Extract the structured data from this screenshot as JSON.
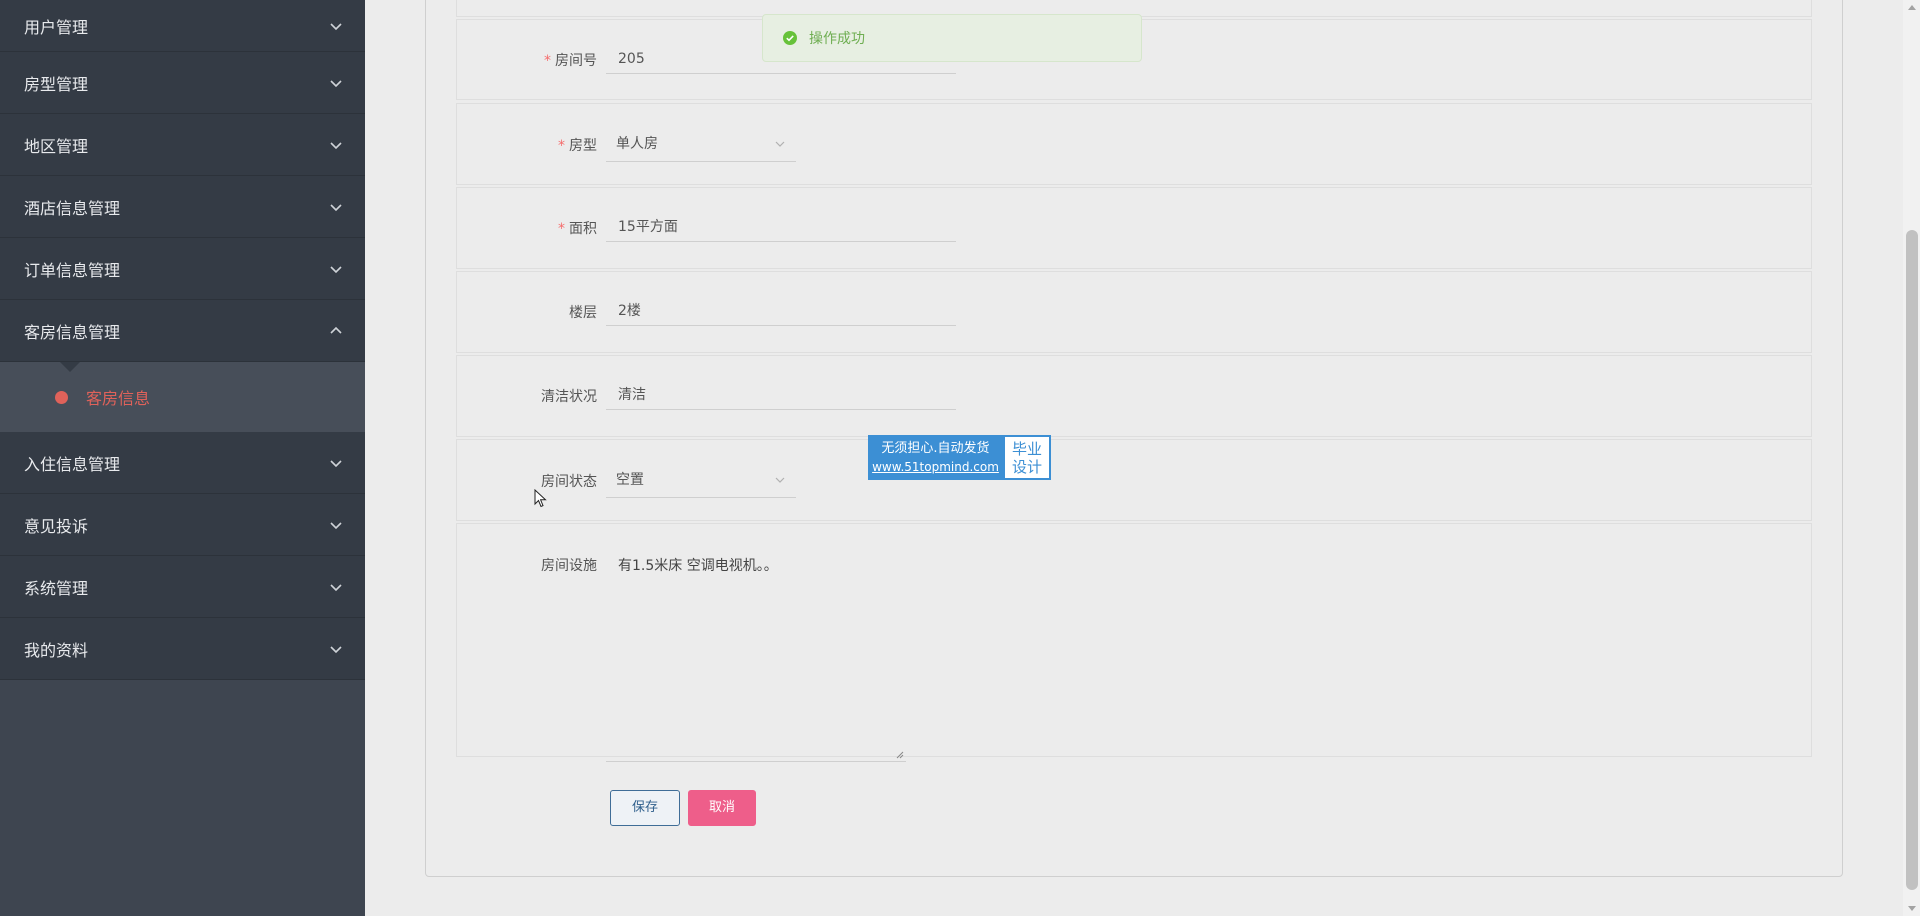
{
  "sidebar": {
    "items": [
      {
        "label": "用户管理",
        "icon": "chevron-down-icon"
      },
      {
        "label": "房型管理",
        "icon": "chevron-down-icon"
      },
      {
        "label": "地区管理",
        "icon": "chevron-down-icon"
      },
      {
        "label": "酒店信息管理",
        "icon": "chevron-down-icon"
      },
      {
        "label": "订单信息管理",
        "icon": "chevron-down-icon"
      },
      {
        "label": "客房信息管理",
        "icon": "chevron-up-icon"
      },
      {
        "label": "入住信息管理",
        "icon": "chevron-down-icon"
      },
      {
        "label": "意见投诉",
        "icon": "chevron-down-icon"
      },
      {
        "label": "系统管理",
        "icon": "chevron-down-icon"
      },
      {
        "label": "我的资料",
        "icon": "chevron-down-icon"
      }
    ],
    "active_sub": "客房信息"
  },
  "toast": {
    "message": "操作成功"
  },
  "form": {
    "room_no": {
      "label": "房间号",
      "value": "205"
    },
    "room_type": {
      "label": "房型",
      "value": "单人房"
    },
    "area": {
      "label": "面积",
      "value": "15平方面"
    },
    "floor": {
      "label": "楼层",
      "value": "2楼"
    },
    "clean_status": {
      "label": "清洁状况",
      "value": "清洁"
    },
    "room_status": {
      "label": "房间状态",
      "value": "空置"
    },
    "facilities": {
      "label": "房间设施",
      "value": "有1.5米床 空调电视机。。"
    }
  },
  "buttons": {
    "save": "保存",
    "cancel": "取消"
  },
  "watermark": {
    "line1": "无须担心.自动发货",
    "url": "www.51topmind.com",
    "right1": "毕业",
    "right2": "设计"
  },
  "colors": {
    "sidebar": "#3e4550",
    "accent": "#e0625a",
    "cancel": "#ee5e8a",
    "success": "#6fae52"
  }
}
